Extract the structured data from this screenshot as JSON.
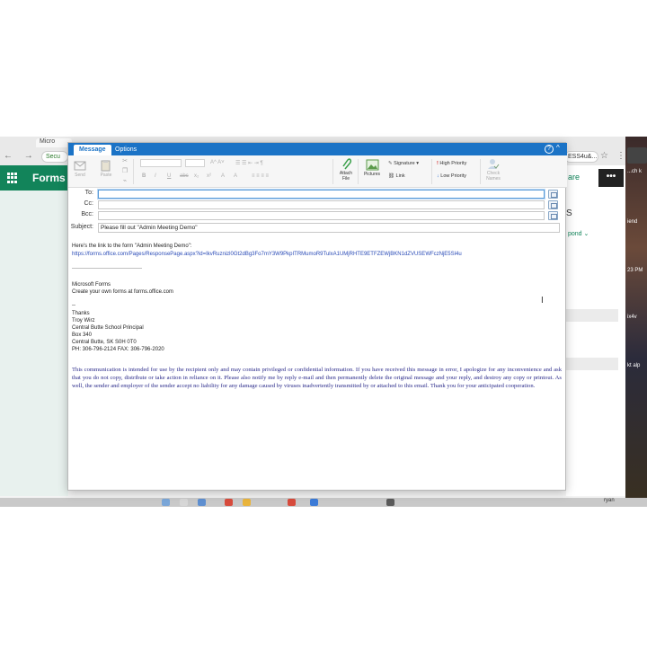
{
  "browser": {
    "tab_title": "Micro",
    "nav_arrows": "← → C",
    "address_left": "Secu",
    "address_right": "ESS4u&...",
    "star_glyph": "☆",
    "kebab_glyph": "⋮"
  },
  "forms_app": {
    "title": "Forms",
    "share_label": "are",
    "more_label": "•••",
    "respond_label": "pond",
    "s_letter": "S"
  },
  "desktop": {
    "labels": [
      "...ch k",
      "iend",
      "23 PM",
      "ix4v",
      "kt alp"
    ],
    "user": "ryan"
  },
  "compose": {
    "tabs": [
      {
        "label": "Message",
        "active": true
      },
      {
        "label": "Options",
        "active": false
      }
    ],
    "help_glyph": "?",
    "collapse_glyph": "^",
    "ribbon": {
      "send": "Send",
      "paste": "Paste",
      "attach_file": "Attach File",
      "pictures": "Pictures",
      "signature": "Signature",
      "link": "Link",
      "high_priority": "High Priority",
      "low_priority": "Low Priority",
      "check_names": "Check Names",
      "format_buttons": [
        "B",
        "I",
        "U",
        "abc",
        "x₂",
        "x²",
        "A",
        "A"
      ]
    },
    "headers": {
      "to_label": "To:",
      "to_value": "",
      "cc_label": "Cc:",
      "cc_value": "",
      "bcc_label": "Bcc:",
      "bcc_value": "",
      "subject_label": "Subject:",
      "subject_value": "Please fill out \"Admin Meeting Demo\""
    },
    "body": {
      "intro": "Here's the link to the form \"Admin Meeting Demo\":",
      "link": "https://forms.office.com/Pages/ResponsePage.aspx?id=IkvRuznizl0Gt2dBg3Fo7mY3W9PkpITRMumoR9TulxA1UMjRHTE9ETFZEWjBKN1dZVUSEWFczNjE5Sl4u",
      "ms_forms": "Microsoft Forms",
      "create_forms": "Create your own forms at forms.office.com",
      "dash": "--",
      "thanks": "Thanks",
      "name": "Troy Wirz",
      "role": "Central Butte School Principal",
      "box": "Box 340",
      "city": "Central Butte, SK S0H 0T0",
      "phone": "PH: 306-796-2124 FAX: 306-796-2020",
      "disclaimer": "This communication is intended for use by the recipient only and may contain privileged or confidential information. If you have received this message in error, I apologize for any inconvenience and ask that you do not copy, distribute or take action in reliance on it. Please also notify me by reply e-mail and then permanently delete the original message and your reply, and destroy any copy or printout. As well, the sender and employer of the sender accept no liability for any damage caused by viruses inadvertently transmitted by or attached to this email. Thank you for your anticipated cooperation."
    }
  },
  "colors": {
    "outlook_blue": "#1b73c6",
    "forms_green": "#12845a",
    "link_blue": "#2a4bb7",
    "disclaimer_navy": "#2a2a8a"
  }
}
